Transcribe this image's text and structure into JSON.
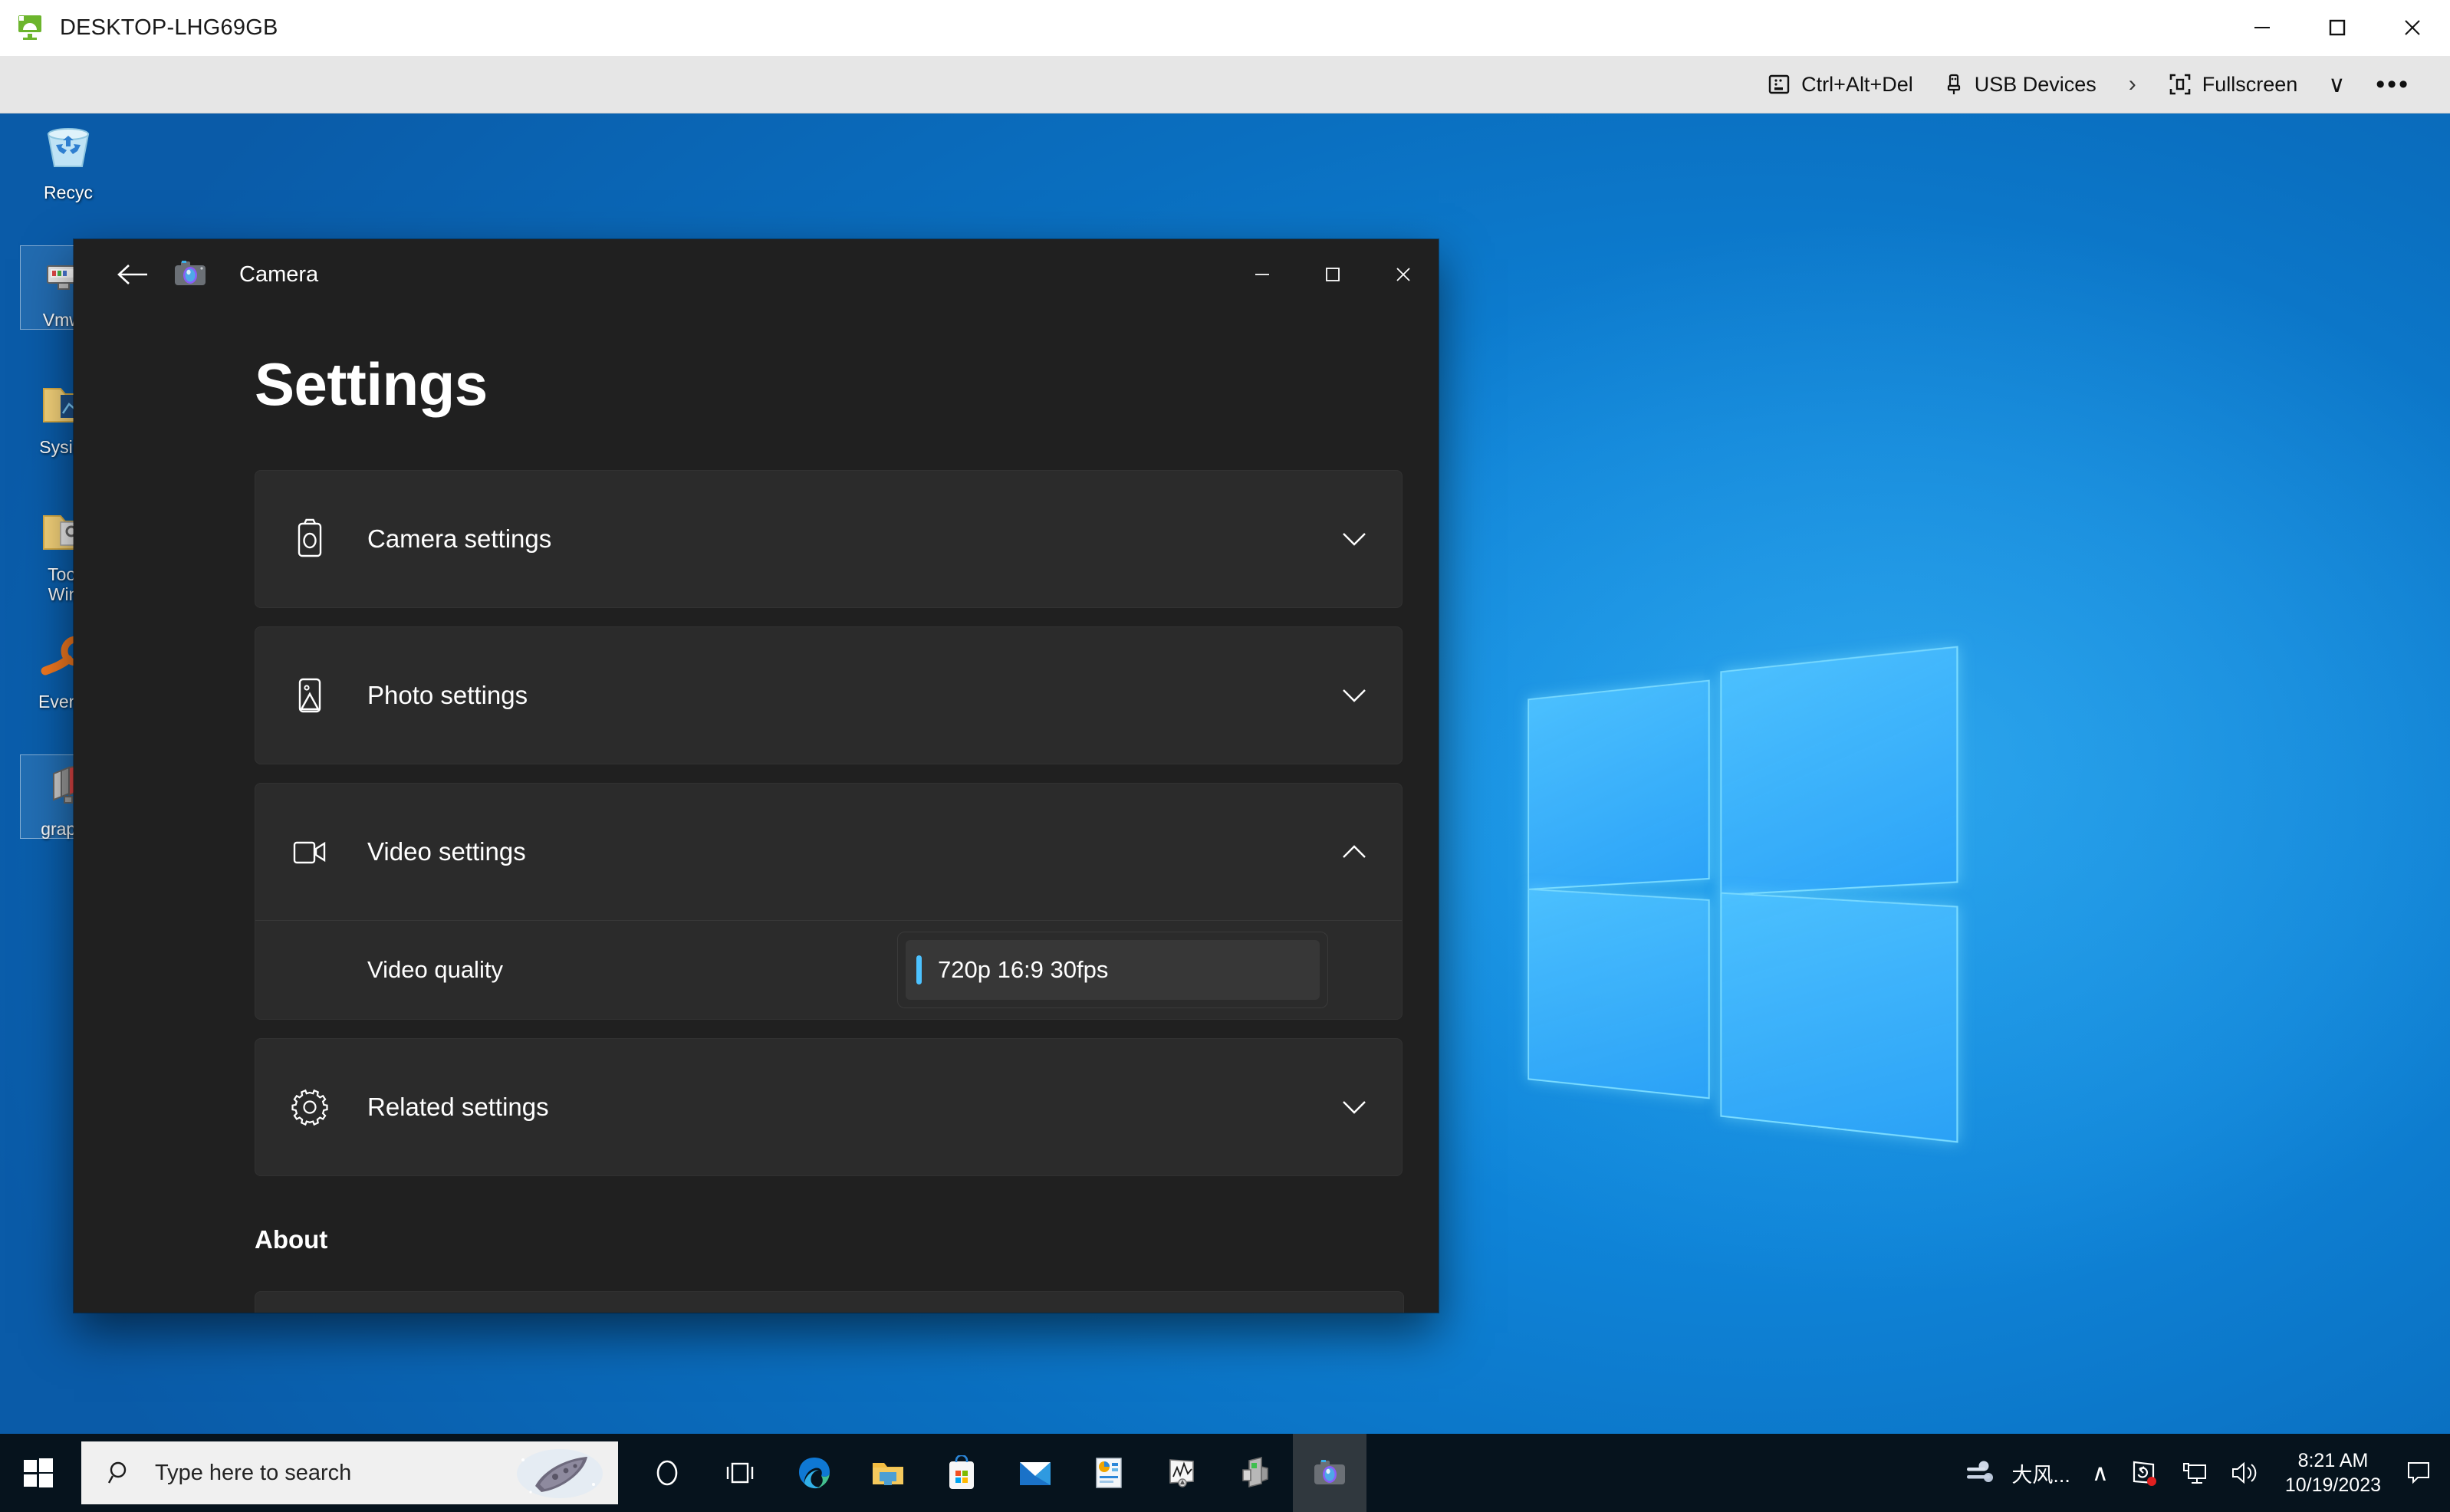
{
  "vmware": {
    "title": "DESKTOP-LHG69GB",
    "title_icon": "vmware-monitor-icon",
    "window_controls": [
      {
        "name": "minimize-button",
        "glyph": "minimize-icon"
      },
      {
        "name": "maximize-button",
        "glyph": "maximize-icon"
      },
      {
        "name": "close-button",
        "glyph": "close-icon"
      }
    ],
    "toolbar": {
      "ctrl_alt_del": "Ctrl+Alt+Del",
      "usb_devices": "USB Devices",
      "separator": "›",
      "fullscreen": "Fullscreen",
      "dropdown": "∨",
      "more": "•••"
    }
  },
  "desktop": {
    "icons": [
      {
        "label": "Recyc",
        "icon": "recycle-bin-icon",
        "selected": false
      },
      {
        "label": "VmwA",
        "icon": "vmware-app-icon",
        "selected": true
      },
      {
        "label": "Sysinte",
        "icon": "folder-sysinternals-icon",
        "selected": false
      },
      {
        "label": "Tools\nWind",
        "icon": "folder-tools-icon",
        "selected": false
      },
      {
        "label": "Everyth",
        "icon": "everything-search-icon",
        "selected": false
      },
      {
        "label": "graphe",
        "icon": "grapher-app-icon",
        "selected": true
      }
    ]
  },
  "camera_app": {
    "window_title": "Camera",
    "app_icon": "camera-app-icon",
    "back_button": "back-arrow-icon",
    "window_controls": [
      {
        "name": "minimize-button",
        "glyph": "minimize-icon"
      },
      {
        "name": "maximize-button",
        "glyph": "maximize-icon"
      },
      {
        "name": "close-button",
        "glyph": "close-icon"
      }
    ],
    "page_title": "Settings",
    "sections": [
      {
        "label": "Camera settings",
        "icon": "camera-outline-icon",
        "expanded": false,
        "chevron": "chevron-down-icon"
      },
      {
        "label": "Photo settings",
        "icon": "photo-image-icon",
        "expanded": false,
        "chevron": "chevron-down-icon"
      },
      {
        "label": "Video settings",
        "icon": "video-camera-icon",
        "expanded": true,
        "chevron": "chevron-up-icon",
        "rows": [
          {
            "label": "Video quality",
            "control": "dropdown",
            "selected_value": "720p 16:9 30fps",
            "accent_color": "#4cc2ff"
          }
        ]
      },
      {
        "label": "Related settings",
        "icon": "gear-icon",
        "expanded": false,
        "chevron": "chevron-down-icon"
      }
    ],
    "about_heading": "About"
  },
  "taskbar": {
    "start_button": "windows-start-icon",
    "search_placeholder": "Type here to search",
    "search_icon": "search-icon",
    "apps": [
      {
        "name": "cortana-icon",
        "active": false
      },
      {
        "name": "task-view-icon",
        "active": false
      },
      {
        "name": "microsoft-edge-icon",
        "active": false
      },
      {
        "name": "file-explorer-icon",
        "active": false
      },
      {
        "name": "microsoft-store-icon",
        "active": false
      },
      {
        "name": "mail-icon",
        "active": false
      },
      {
        "name": "office-app-icon",
        "active": false
      },
      {
        "name": "performance-monitor-icon",
        "active": false
      },
      {
        "name": "dev-tool-icon",
        "active": false
      },
      {
        "name": "camera-taskbar-icon",
        "active": true
      }
    ],
    "tray": {
      "weather_icon": "wind-weather-icon",
      "weather_text": "大风...",
      "show_hidden": "∧",
      "sync_icon": "onedrive-sync-icon",
      "network_icon": "network-monitor-icon",
      "volume_icon": "volume-icon",
      "time": "8:21 AM",
      "date": "10/19/2023",
      "action_center": "notification-icon"
    }
  },
  "colors": {
    "app_background": "#202020",
    "card_background": "#2b2b2b",
    "combo_item_background": "#373737",
    "accent": "#4cc2ff",
    "taskbar": "#06131d",
    "vm_toolbar": "#e6e6e6"
  }
}
